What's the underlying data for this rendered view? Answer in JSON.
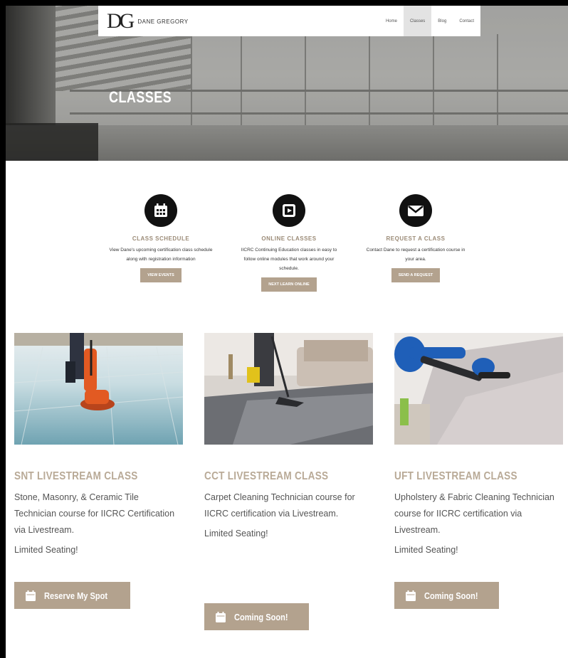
{
  "nav": {
    "logo_mark": "DG",
    "logo_name": "DANE GREGORY",
    "items": [
      {
        "label": "Home"
      },
      {
        "label": "Classes"
      },
      {
        "label": "Blog"
      },
      {
        "label": "Contact"
      }
    ]
  },
  "hero": {
    "title": "CLASSES"
  },
  "features": [
    {
      "icon": "calendar-icon",
      "title": "CLASS SCHEDULE",
      "desc": "View Dane's upcoming certification class schedule along with registration information",
      "button": "VIEW EVENTS"
    },
    {
      "icon": "play-icon",
      "title": "ONLINE CLASSES",
      "desc": "IICRC Continuing Education classes in easy to follow online modules that work around your schedule.",
      "button": "NEXT LEARN ONLINE"
    },
    {
      "icon": "envelope-icon",
      "title": "REQUEST A CLASS",
      "desc": "Contact Dane to request a certification course in your area.",
      "button": "SEND A REQUEST"
    }
  ],
  "cards": [
    {
      "title": "SNT LIVESTREAM CLASS",
      "desc": "Stone, Masonry, & Ceramic Tile Technician course for IICRC Certification via Livestream.",
      "seating": "Limited Seating!",
      "button": "Reserve My Spot"
    },
    {
      "title": "CCT LIVESTREAM CLASS",
      "desc": "Carpet Cleaning Technician course for IICRC certification via Livestream.",
      "seating": "Limited Seating!",
      "button": "Coming Soon!"
    },
    {
      "title": "UFT LIVESTREAM CLASS",
      "desc": "Upholstery & Fabric Cleaning Technician course for IICRC certification via Livestream.",
      "seating": "Limited Seating!",
      "button": "Coming Soon!"
    }
  ],
  "colors": {
    "accent": "#b3a28e",
    "heading": "#b9aa97",
    "icon_bg": "#111111"
  }
}
